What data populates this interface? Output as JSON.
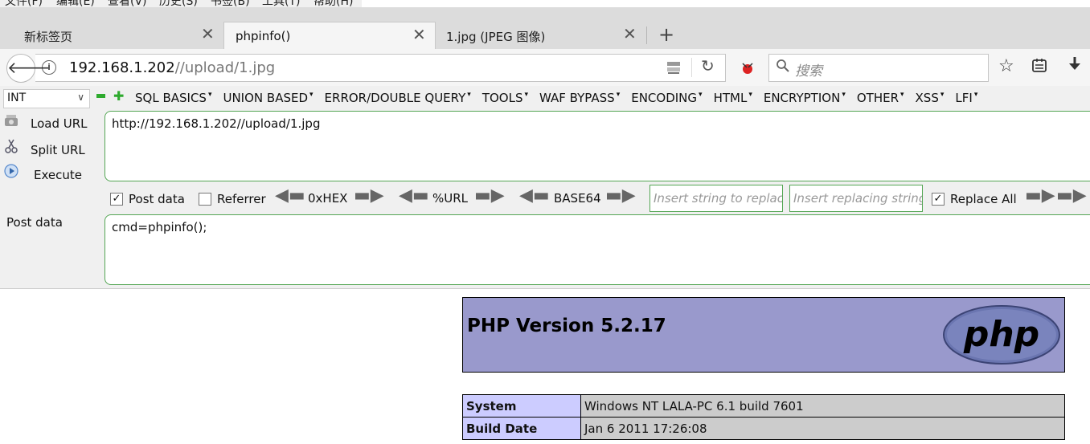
{
  "menubar": {
    "items": [
      "文件(F)",
      "编辑(E)",
      "查看(V)",
      "历史(S)",
      "书签(B)",
      "工具(T)",
      "帮助(H)"
    ]
  },
  "tabs": [
    {
      "label": "新标签页",
      "active": false
    },
    {
      "label": "phpinfo()",
      "active": true
    },
    {
      "label": "1.jpg (JPEG 图像)",
      "active": false
    }
  ],
  "new_tab_icon": "+",
  "navbar": {
    "url_host": "192.168.1.202",
    "url_path": "//upload/1.jpg",
    "search_placeholder": "搜索"
  },
  "hackbar": {
    "select_value": "INT",
    "menu": [
      "SQL BASICS",
      "UNION BASED",
      "ERROR/DOUBLE QUERY",
      "TOOLS",
      "WAF BYPASS",
      "ENCODING",
      "HTML",
      "ENCRYPTION",
      "OTHER",
      "XSS",
      "LFI"
    ],
    "actions": {
      "load": "Load URL",
      "split": "Split URL",
      "execute": "Execute"
    },
    "url_value": "http://192.168.1.202//upload/1.jpg",
    "options": {
      "post_data_label": "Post data",
      "post_data_checked": true,
      "referrer_label": "Referrer",
      "referrer_checked": false,
      "hex_label": "0xHEX",
      "url_label": "%URL",
      "base64_label": "BASE64",
      "replace_from_placeholder": "Insert string to replace",
      "replace_to_placeholder": "Insert replacing string",
      "replace_all_label": "Replace All",
      "replace_all_checked": true
    },
    "post_label": "Post data",
    "post_value": "cmd=phpinfo();"
  },
  "phpinfo": {
    "title": "PHP Version 5.2.17",
    "logo_text": "php",
    "rows": [
      {
        "key": "System",
        "value": "Windows NT LALA-PC 6.1 build 7601"
      },
      {
        "key": "Build Date",
        "value": "Jan 6 2011 17:26:08"
      }
    ]
  },
  "colors": {
    "php_header_bg": "#9999cc",
    "php_key_bg": "#ccccff",
    "php_value_bg": "#cccccc",
    "hackbar_border": "#54a654"
  }
}
